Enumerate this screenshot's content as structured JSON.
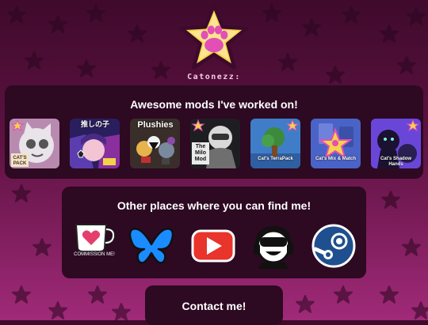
{
  "brand": {
    "name": "Catonezz:",
    "logo_icon": "paw-star-icon",
    "star_color": "#f7d24c",
    "paw_color": "#e24fb5"
  },
  "mods_section": {
    "title": "Awesome mods I've worked on!",
    "mods": [
      {
        "name": "Cat's Pack",
        "label": "CAT'S PACK",
        "icon": "cat-face-thumbnail-icon"
      },
      {
        "name": "Oshi no Ko",
        "label": "推しの子",
        "icon": "oshi-no-ko-thumbnail-icon"
      },
      {
        "name": "Plushies",
        "label": "Plushies",
        "icon": "plushies-thumbnail-icon"
      },
      {
        "name": "The Milo Mod",
        "label": "The Milo Mod",
        "icon": "milo-thumbnail-icon"
      },
      {
        "name": "Cat's TerraPack",
        "label": "Cat's TerraPack",
        "icon": "terrapack-thumbnail-icon"
      },
      {
        "name": "Cat's Mix & Match",
        "label": "Cat's Mix & Match",
        "icon": "mix-match-thumbnail-icon"
      },
      {
        "name": "Cat's Shadow Hands",
        "label": "Cat's Shadow Hands",
        "icon": "shadow-hands-thumbnail-icon"
      }
    ]
  },
  "links_section": {
    "title": "Other places where you can find me!",
    "links": [
      {
        "name": "Ko-fi",
        "caption": "COMMISSION ME!",
        "icon": "kofi-cup-icon"
      },
      {
        "name": "Bluesky",
        "icon": "bluesky-butterfly-icon"
      },
      {
        "name": "YouTube",
        "icon": "youtube-play-icon"
      },
      {
        "name": "Balatro mods community",
        "icon": "headphones-face-icon"
      },
      {
        "name": "Steam",
        "icon": "steam-icon"
      }
    ]
  },
  "contact": {
    "title": "Contact me!"
  },
  "colors": {
    "background_top": "#3f0a2c",
    "background_bottom": "#a02a78",
    "panel": "#2d0922",
    "accent_pink": "#e24fb5"
  }
}
